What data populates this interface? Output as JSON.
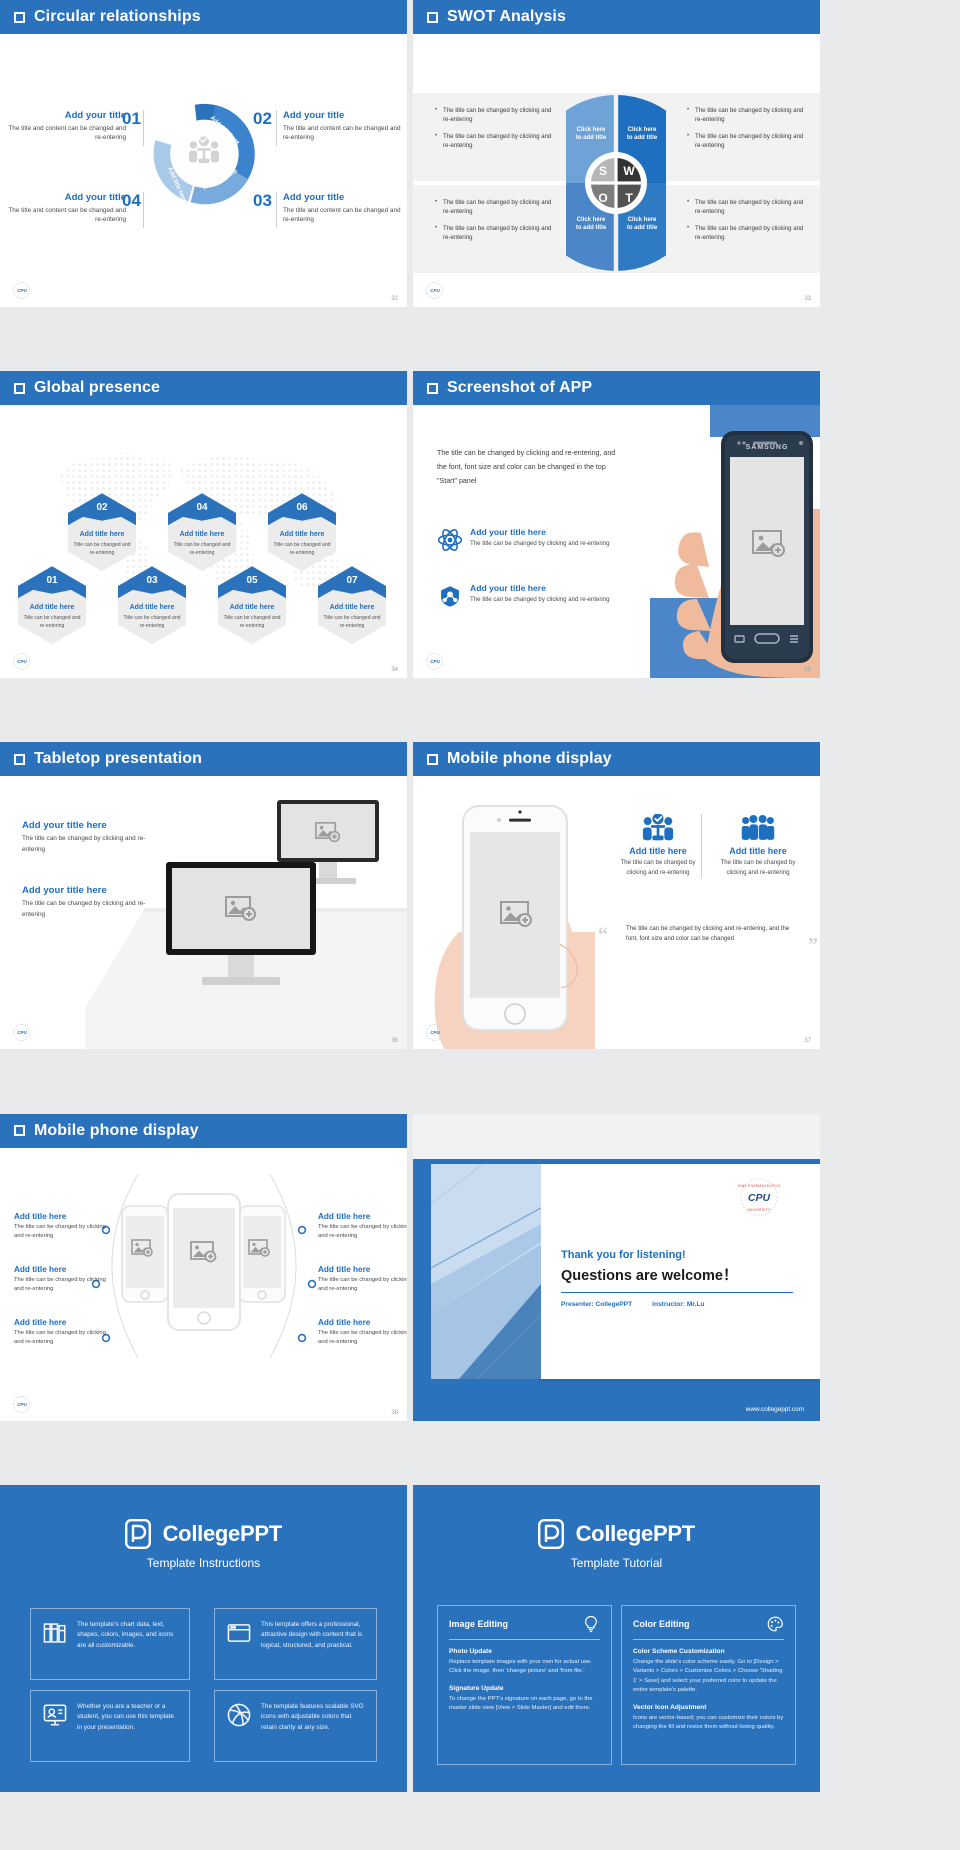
{
  "accent": "#2b72bd",
  "accent_light": "#6fa3d8",
  "accent_dark": "#1f6fc0",
  "slides": {
    "circular": {
      "title": "Circular relationships",
      "page": "32",
      "items": [
        {
          "num": "01",
          "title": "Add your title",
          "desc": "The title and content can be changed and re-entering",
          "ring": "Add title here"
        },
        {
          "num": "02",
          "title": "Add your title",
          "desc": "The title and content can be changed and re-entering",
          "ring": "Add title here"
        },
        {
          "num": "03",
          "title": "Add your title",
          "desc": "The title and content can be changed and re-entering",
          "ring": "Add title here"
        },
        {
          "num": "04",
          "title": "Add your title",
          "desc": "The title and content can be changed and re-entering",
          "ring": "Add title here"
        }
      ]
    },
    "swot": {
      "title": "SWOT Analysis",
      "page": "33",
      "letters": [
        "S",
        "W",
        "O",
        "T"
      ],
      "quadrant_label": "Click here\nto add title",
      "quadrants": [
        {
          "letter": "S",
          "label_line1": "Click here",
          "label_line2": "to add title"
        },
        {
          "letter": "W",
          "label_line1": "Click here",
          "label_line2": "to add title"
        },
        {
          "letter": "O",
          "label_line1": "Click here",
          "label_line2": "to add title"
        },
        {
          "letter": "T",
          "label_line1": "Click here",
          "label_line2": "to add title"
        }
      ],
      "bullets": [
        "The title can be changed by clicking and re-entering",
        "The title can be changed by clicking and re-entering",
        "The title can be changed by clicking and re-entering",
        "The title can be changed by clicking and re-entering",
        "The title can be changed by clicking and re-entering",
        "The title can be changed by clicking and re-entering",
        "The title can be changed by clicking and re-entering",
        "The title can be changed by clicking and re-entering"
      ]
    },
    "global": {
      "title": "Global presence",
      "page": "34",
      "items": [
        {
          "num": "01",
          "title": "Add title here",
          "desc": "Title can be changed and re-entering"
        },
        {
          "num": "02",
          "title": "Add title here",
          "desc": "Title can be changed and re-entering"
        },
        {
          "num": "03",
          "title": "Add title here",
          "desc": "Title can be changed and re-entering"
        },
        {
          "num": "04",
          "title": "Add title here",
          "desc": "Title can be changed and re-entering"
        },
        {
          "num": "05",
          "title": "Add title here",
          "desc": "Title can be changed and re-entering"
        },
        {
          "num": "06",
          "title": "Add title here",
          "desc": "Title can be changed and re-entering"
        },
        {
          "num": "07",
          "title": "Add title here",
          "desc": "Title can be changed and re-entering"
        }
      ]
    },
    "app": {
      "title": "Screenshot of APP",
      "page": "35",
      "paragraph": "The title can be changed by clicking and re-entering, and the font, font size and color can be changed in the top \"Start\" panel",
      "phone_brand": "SAMSUNG",
      "features": [
        {
          "icon": "atom-icon",
          "title": "Add your title here",
          "desc": "The title can be changed by clicking and re-entering"
        },
        {
          "icon": "network-shield-icon",
          "title": "Add your title here",
          "desc": "The title can be changed by clicking and re-entering"
        }
      ]
    },
    "tabletop": {
      "title": "Tabletop presentation",
      "page": "36",
      "items": [
        {
          "title": "Add your title here",
          "desc": "The title can be changed by clicking and re-entering"
        },
        {
          "title": "Add your title here",
          "desc": "The title can be changed by clicking and re-entering"
        }
      ]
    },
    "mobile1": {
      "title": "Mobile phone display",
      "page": "37",
      "cards": [
        {
          "icon": "team-check-icon",
          "title": "Add title here",
          "desc": "The title can be changed by clicking and re-entering"
        },
        {
          "icon": "people-group-icon",
          "title": "Add title here",
          "desc": "The title can be changed by clicking and re-entering"
        }
      ],
      "quote": "The title can be changed by clicking and re-entering, and the font, font size and color can be changed"
    },
    "mobile2": {
      "title": "Mobile phone display",
      "page": "38",
      "left": [
        {
          "title": "Add title here",
          "desc": "The title can be changed by clicking and re-entering"
        },
        {
          "title": "Add title here",
          "desc": "The title can be changed by clicking and re-entering"
        },
        {
          "title": "Add title here",
          "desc": "The title can be changed by clicking and re-entering"
        }
      ],
      "right": [
        {
          "title": "Add title here",
          "desc": "The title can be changed by clicking and re-entering"
        },
        {
          "title": "Add title here",
          "desc": "The title can be changed by clicking and re-entering"
        },
        {
          "title": "Add title here",
          "desc": "The title can be changed by clicking and re-entering"
        }
      ]
    },
    "thanks": {
      "line1": "Thank you for listening!",
      "line2": "Questions are welcome！",
      "presenter_label": "Presenter:",
      "presenter": "CollegePPT",
      "instructor_label": "Instructor:",
      "instructor": "Mr.Lu",
      "url": "www.collegeppt.com",
      "logo_text": "CPU"
    },
    "instructions": {
      "brand": "CollegePPT",
      "subtitle": "Template Instructions",
      "cards": [
        {
          "icon": "books-icon",
          "text": "The template's chart data, text, shapes, colors, images, and icons are all customizable."
        },
        {
          "icon": "window-icon",
          "text": "This template offers a professional, attractive design with content that is logical, structured, and practical."
        },
        {
          "icon": "presenter-icon",
          "text": "Whether you are a teacher or a student, you can use this template in your presentation."
        },
        {
          "icon": "dribbble-icon",
          "text": "The template features scalable SVG icons with adjustable colors that retain clarity at any size."
        }
      ]
    },
    "tutorial": {
      "brand": "CollegePPT",
      "subtitle": "Template Tutorial",
      "columns": [
        {
          "header": "Image Editing",
          "icon": "lightbulb-icon",
          "sections": [
            {
              "heading": "Photo Update",
              "body": "Replace template images with your own for actual use. Click the image, then 'change picture' and 'from file.'"
            },
            {
              "heading": "Signature Update",
              "body": "To change the PPT's signature on each page, go to the master slide view [View > Slide Master] and edit there."
            }
          ]
        },
        {
          "header": "Color Editing",
          "icon": "palette-icon",
          "sections": [
            {
              "heading": "Color Scheme Customization",
              "body": "Change the slide's color scheme easily. Go to [Design > Variants > Colors > Customize Colors > Choose 'Shading 1' > Save] and select your preferred color to update the entire template's palette."
            },
            {
              "heading": "Vector Icon Adjustment",
              "body": "Icons are vector-based; you can customize their colors by changing the fill and resize them without losing quality."
            }
          ]
        }
      ]
    }
  }
}
